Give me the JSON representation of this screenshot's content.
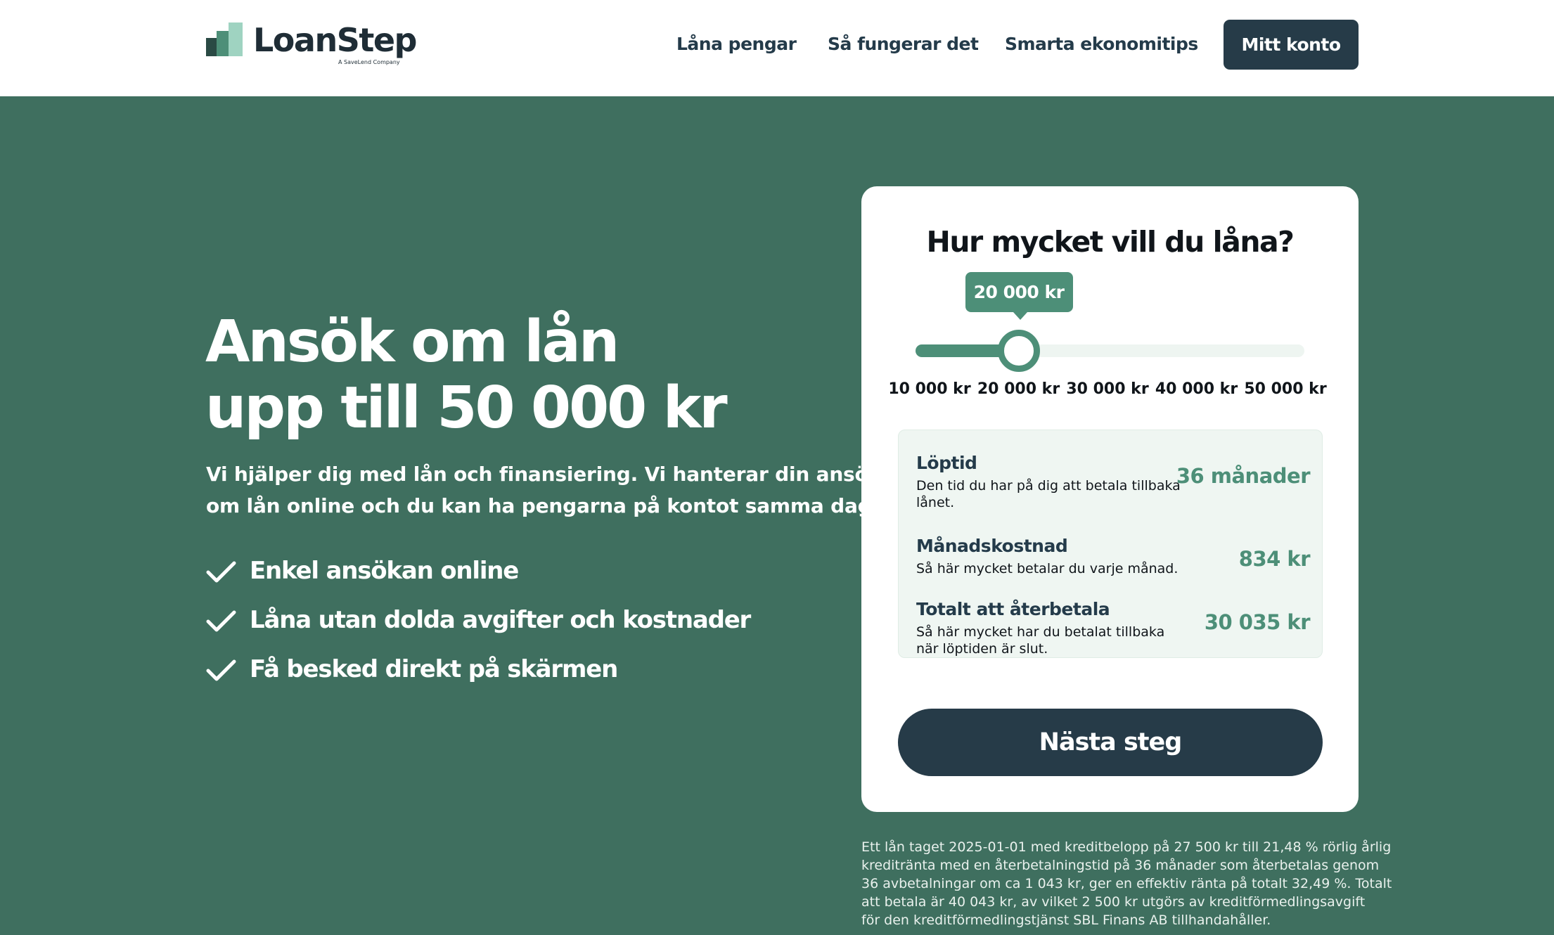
{
  "header": {
    "logo": {
      "name": "LoanStep",
      "tagline": "A SaveLend Company"
    },
    "nav": [
      {
        "label": "Låna pengar"
      },
      {
        "label": "Så fungerar det"
      },
      {
        "label": "Smarta ekonomitips"
      }
    ],
    "account_button": "Mitt konto"
  },
  "hero": {
    "title_line1": "Ansök om lån",
    "title_line2": "upp till 50 000 kr",
    "subtitle_line1": "Vi hjälper dig med lån och finansiering. Vi hanterar din ansökan",
    "subtitle_line2": "om lån online och du kan ha pengarna på kontot samma dag.",
    "features": [
      {
        "text": "Enkel ansökan online",
        "icon": "check-icon"
      },
      {
        "text": "Låna utan dolda avgifter och kostnader",
        "icon": "check-icon"
      },
      {
        "text": "Få besked direkt på skärmen",
        "icon": "check-icon"
      }
    ]
  },
  "calculator": {
    "title": "Hur mycket vill du låna?",
    "slider": {
      "min": 10000,
      "max": 50000,
      "value": 20000,
      "value_label": "20 000 kr",
      "ticks": [
        "10 000 kr",
        "20 000 kr",
        "30 000 kr",
        "40 000 kr",
        "50 000 kr"
      ]
    },
    "summary": [
      {
        "label": "Löptid",
        "description": "Den tid du har på dig att betala tillbaka lånet.",
        "value": "36 månader"
      },
      {
        "label": "Månadskostnad",
        "description": "Så här mycket betalar du varje månad.",
        "value": "834 kr"
      },
      {
        "label": "Totalt att återbetala",
        "description": "Så här mycket har du betalat tillbaka när löptiden är slut.",
        "value": "30 035 kr"
      }
    ],
    "next_button": "Nästa steg"
  },
  "disclaimer": [
    "Ett lån taget 2025-01-01 med kreditbelopp på 27 500 kr till 21,48 % rörlig årlig",
    "kreditränta med en återbetalningstid på 36 månader som återbetalas genom",
    "36 avbetalningar om ca 1 043 kr, ger en effektiv ränta på totalt 32,49 %. Totalt",
    "att betala är 40 043 kr, av vilket 2 500 kr utgörs av kreditförmedlingsavgift",
    "för den kreditförmedlingstjänst SBL Finans AB tillhandahåller."
  ],
  "colors": {
    "background": "#3f6f5f",
    "brand_green": "#4d8f78",
    "navy": "#263b48",
    "light_green": "#eff6f2"
  }
}
